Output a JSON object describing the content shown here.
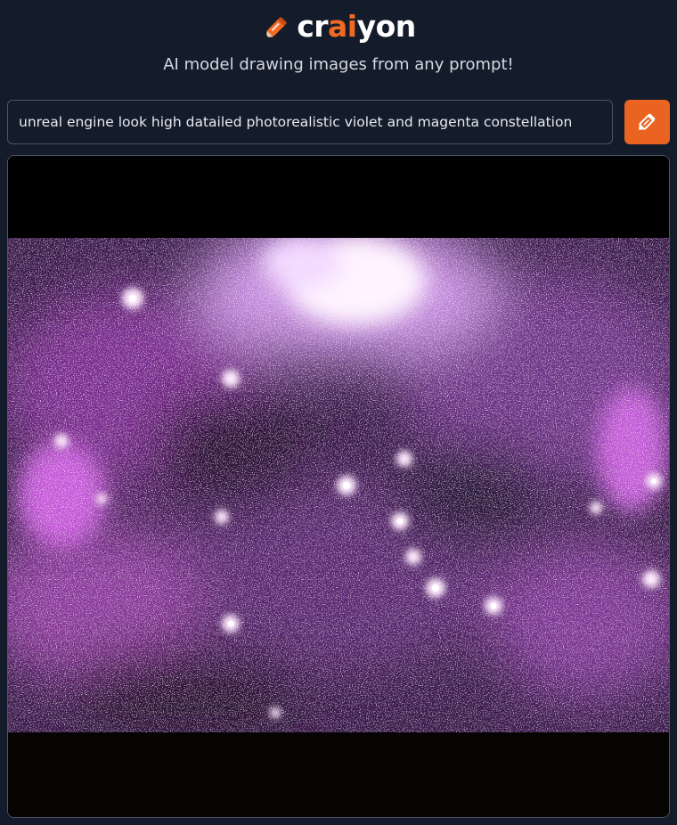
{
  "brand": {
    "name_prefix": "cr",
    "name_accent": "ai",
    "name_suffix": "yon",
    "accent_color": "#f26a21",
    "icon": "pencil-icon"
  },
  "tagline": "AI model drawing images from any prompt!",
  "prompt": {
    "value": "unreal engine look high datailed photorealistic violet and magenta constellation"
  },
  "draw_button": {
    "icon": "pencil-icon",
    "color": "#ea6320"
  },
  "result": {
    "image_subject": "violet and magenta starfield nebula",
    "colors": [
      "#000000",
      "#b64ad8",
      "#ff7af2",
      "#ffffff"
    ]
  }
}
